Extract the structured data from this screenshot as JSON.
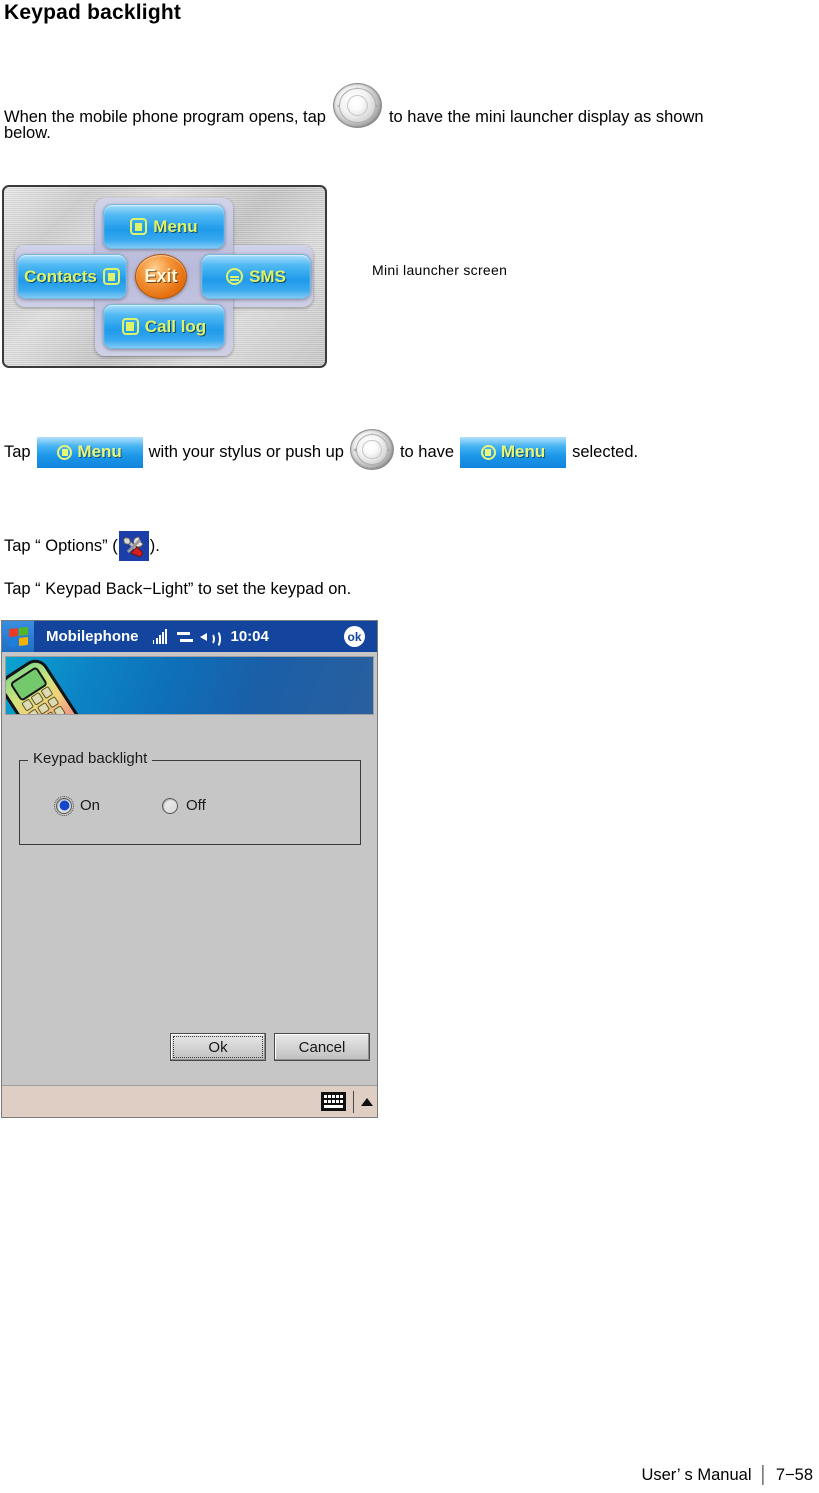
{
  "heading": "Keypad backlight",
  "paragraphs": {
    "intro_before_icon": "When the mobile phone program opens, tap",
    "intro_after_icon": "to have the mini launcher display as shown",
    "intro_line2": "below.",
    "tap_prefix": "Tap",
    "tap_middle": "with your stylus or push up",
    "tap_to_have": "to have",
    "tap_suffix": "selected.",
    "options_line": "Tap “ Options” (",
    "options_line_end": ").",
    "keypad_line": "Tap “ Keypad Back−Light”  to set the keypad on."
  },
  "launcher": {
    "caption": "Mini launcher screen",
    "buttons": {
      "menu": "Menu",
      "contacts": "Contacts",
      "sms": "SMS",
      "call_log": "Call log",
      "exit": "Exit"
    },
    "icons": {
      "menu": "menu-badge-icon",
      "contacts": "contacts-book-icon",
      "sms": "envelope-icon",
      "call_log": "call-log-icon"
    }
  },
  "inline_badges": {
    "menu_label": "Menu",
    "menu_icon": "menu-badge-icon",
    "dpad_icon": "navigation-dpad-icon",
    "options_icon": "tools-options-icon"
  },
  "pda": {
    "titlebar": {
      "start_icon": "windows-start-icon",
      "title": "Mobilephone",
      "signal_icon": "signal-strength-icon",
      "connection_icon": "connectivity-icon",
      "volume_icon": "speaker-volume-icon",
      "clock": "10:04",
      "ok_label": "ok"
    },
    "banner": {
      "art": "mobile-phone-illustration"
    },
    "group": {
      "legend": "Keypad backlight",
      "options": [
        {
          "label": "On",
          "checked": true
        },
        {
          "label": "Off",
          "checked": false
        }
      ]
    },
    "buttons": {
      "ok": "Ok",
      "cancel": "Cancel"
    },
    "taskbar": {
      "sip_icon": "soft-input-keyboard-icon",
      "sip_arrow_icon": "sip-chevron-up-icon"
    }
  },
  "footer": {
    "manual": "User’ s Manual",
    "separator": "│",
    "page": "7−58"
  },
  "colors": {
    "titlebar_blue": "#14459e",
    "pda_gray": "#c6c6c6",
    "taskbar_beige": "#dfcec4",
    "badge_blue": "#1b96e8",
    "badge_text": "#ddf46a",
    "exit_orange": "#e5700f",
    "radio_blue": "#1447c9"
  }
}
